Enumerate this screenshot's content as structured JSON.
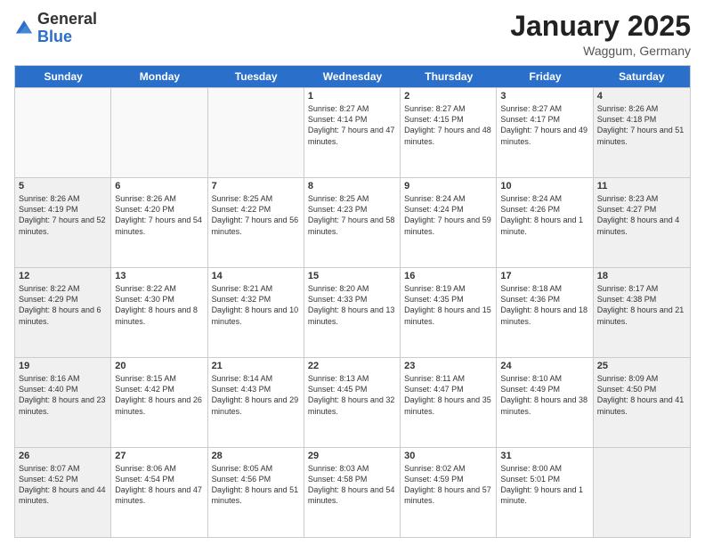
{
  "header": {
    "logo": {
      "general": "General",
      "blue": "Blue"
    },
    "title": "January 2025",
    "location": "Waggum, Germany"
  },
  "calendar": {
    "days_of_week": [
      "Sunday",
      "Monday",
      "Tuesday",
      "Wednesday",
      "Thursday",
      "Friday",
      "Saturday"
    ],
    "weeks": [
      [
        {
          "day": "",
          "empty": true,
          "shaded": false
        },
        {
          "day": "",
          "empty": true,
          "shaded": false
        },
        {
          "day": "",
          "empty": true,
          "shaded": false
        },
        {
          "day": "1",
          "empty": false,
          "shaded": false,
          "sunrise": "8:27 AM",
          "sunset": "4:14 PM",
          "daylight": "7 hours and 47 minutes."
        },
        {
          "day": "2",
          "empty": false,
          "shaded": false,
          "sunrise": "8:27 AM",
          "sunset": "4:15 PM",
          "daylight": "7 hours and 48 minutes."
        },
        {
          "day": "3",
          "empty": false,
          "shaded": false,
          "sunrise": "8:27 AM",
          "sunset": "4:17 PM",
          "daylight": "7 hours and 49 minutes."
        },
        {
          "day": "4",
          "empty": false,
          "shaded": true,
          "sunrise": "8:26 AM",
          "sunset": "4:18 PM",
          "daylight": "7 hours and 51 minutes."
        }
      ],
      [
        {
          "day": "5",
          "empty": false,
          "shaded": true,
          "sunrise": "8:26 AM",
          "sunset": "4:19 PM",
          "daylight": "7 hours and 52 minutes."
        },
        {
          "day": "6",
          "empty": false,
          "shaded": false,
          "sunrise": "8:26 AM",
          "sunset": "4:20 PM",
          "daylight": "7 hours and 54 minutes."
        },
        {
          "day": "7",
          "empty": false,
          "shaded": false,
          "sunrise": "8:25 AM",
          "sunset": "4:22 PM",
          "daylight": "7 hours and 56 minutes."
        },
        {
          "day": "8",
          "empty": false,
          "shaded": false,
          "sunrise": "8:25 AM",
          "sunset": "4:23 PM",
          "daylight": "7 hours and 58 minutes."
        },
        {
          "day": "9",
          "empty": false,
          "shaded": false,
          "sunrise": "8:24 AM",
          "sunset": "4:24 PM",
          "daylight": "7 hours and 59 minutes."
        },
        {
          "day": "10",
          "empty": false,
          "shaded": false,
          "sunrise": "8:24 AM",
          "sunset": "4:26 PM",
          "daylight": "8 hours and 1 minute."
        },
        {
          "day": "11",
          "empty": false,
          "shaded": true,
          "sunrise": "8:23 AM",
          "sunset": "4:27 PM",
          "daylight": "8 hours and 4 minutes."
        }
      ],
      [
        {
          "day": "12",
          "empty": false,
          "shaded": true,
          "sunrise": "8:22 AM",
          "sunset": "4:29 PM",
          "daylight": "8 hours and 6 minutes."
        },
        {
          "day": "13",
          "empty": false,
          "shaded": false,
          "sunrise": "8:22 AM",
          "sunset": "4:30 PM",
          "daylight": "8 hours and 8 minutes."
        },
        {
          "day": "14",
          "empty": false,
          "shaded": false,
          "sunrise": "8:21 AM",
          "sunset": "4:32 PM",
          "daylight": "8 hours and 10 minutes."
        },
        {
          "day": "15",
          "empty": false,
          "shaded": false,
          "sunrise": "8:20 AM",
          "sunset": "4:33 PM",
          "daylight": "8 hours and 13 minutes."
        },
        {
          "day": "16",
          "empty": false,
          "shaded": false,
          "sunrise": "8:19 AM",
          "sunset": "4:35 PM",
          "daylight": "8 hours and 15 minutes."
        },
        {
          "day": "17",
          "empty": false,
          "shaded": false,
          "sunrise": "8:18 AM",
          "sunset": "4:36 PM",
          "daylight": "8 hours and 18 minutes."
        },
        {
          "day": "18",
          "empty": false,
          "shaded": true,
          "sunrise": "8:17 AM",
          "sunset": "4:38 PM",
          "daylight": "8 hours and 21 minutes."
        }
      ],
      [
        {
          "day": "19",
          "empty": false,
          "shaded": true,
          "sunrise": "8:16 AM",
          "sunset": "4:40 PM",
          "daylight": "8 hours and 23 minutes."
        },
        {
          "day": "20",
          "empty": false,
          "shaded": false,
          "sunrise": "8:15 AM",
          "sunset": "4:42 PM",
          "daylight": "8 hours and 26 minutes."
        },
        {
          "day": "21",
          "empty": false,
          "shaded": false,
          "sunrise": "8:14 AM",
          "sunset": "4:43 PM",
          "daylight": "8 hours and 29 minutes."
        },
        {
          "day": "22",
          "empty": false,
          "shaded": false,
          "sunrise": "8:13 AM",
          "sunset": "4:45 PM",
          "daylight": "8 hours and 32 minutes."
        },
        {
          "day": "23",
          "empty": false,
          "shaded": false,
          "sunrise": "8:11 AM",
          "sunset": "4:47 PM",
          "daylight": "8 hours and 35 minutes."
        },
        {
          "day": "24",
          "empty": false,
          "shaded": false,
          "sunrise": "8:10 AM",
          "sunset": "4:49 PM",
          "daylight": "8 hours and 38 minutes."
        },
        {
          "day": "25",
          "empty": false,
          "shaded": true,
          "sunrise": "8:09 AM",
          "sunset": "4:50 PM",
          "daylight": "8 hours and 41 minutes."
        }
      ],
      [
        {
          "day": "26",
          "empty": false,
          "shaded": true,
          "sunrise": "8:07 AM",
          "sunset": "4:52 PM",
          "daylight": "8 hours and 44 minutes."
        },
        {
          "day": "27",
          "empty": false,
          "shaded": false,
          "sunrise": "8:06 AM",
          "sunset": "4:54 PM",
          "daylight": "8 hours and 47 minutes."
        },
        {
          "day": "28",
          "empty": false,
          "shaded": false,
          "sunrise": "8:05 AM",
          "sunset": "4:56 PM",
          "daylight": "8 hours and 51 minutes."
        },
        {
          "day": "29",
          "empty": false,
          "shaded": false,
          "sunrise": "8:03 AM",
          "sunset": "4:58 PM",
          "daylight": "8 hours and 54 minutes."
        },
        {
          "day": "30",
          "empty": false,
          "shaded": false,
          "sunrise": "8:02 AM",
          "sunset": "4:59 PM",
          "daylight": "8 hours and 57 minutes."
        },
        {
          "day": "31",
          "empty": false,
          "shaded": false,
          "sunrise": "8:00 AM",
          "sunset": "5:01 PM",
          "daylight": "9 hours and 1 minute."
        },
        {
          "day": "",
          "empty": true,
          "shaded": true
        }
      ]
    ]
  }
}
